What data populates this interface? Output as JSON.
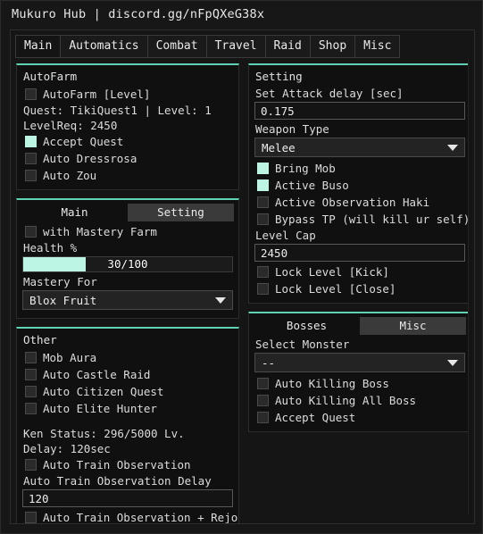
{
  "window": {
    "title": "Mukuro Hub | discord.gg/nFpQXeG38x"
  },
  "tabs": [
    {
      "label": "Main",
      "active": true
    },
    {
      "label": "Automatics",
      "active": false
    },
    {
      "label": "Combat",
      "active": false
    },
    {
      "label": "Travel",
      "active": false
    },
    {
      "label": "Raid",
      "active": false
    },
    {
      "label": "Shop",
      "active": false
    },
    {
      "label": "Misc",
      "active": false
    }
  ],
  "left": {
    "autofarm": {
      "title": "AutoFarm",
      "autofarm_level_label": "AutoFarm [Level]",
      "quest_status": "Quest: TikiQuest1 | Level: 1",
      "level_req": "LevelReq: 2450",
      "accept_quest_label": "Accept Quest",
      "auto_dressrosa_label": "Auto Dressrosa",
      "auto_zou_label": "Auto Zou"
    },
    "mastery": {
      "tab_main": "Main",
      "tab_setting": "Setting",
      "with_mastery_farm_label": "with Mastery Farm",
      "health_label": "Health %",
      "health_value": "30/100",
      "health_percent": 30,
      "mastery_for_label": "Mastery For",
      "mastery_for_value": "Blox Fruit"
    },
    "other": {
      "title": "Other",
      "mob_aura_label": "Mob Aura",
      "auto_castle_raid_label": "Auto Castle Raid",
      "auto_citizen_quest_label": "Auto Citizen Quest",
      "auto_elite_hunter_label": "Auto Elite Hunter",
      "ken_status": "Ken Status: 296/5000 Lv.",
      "delay": "Delay: 120sec",
      "auto_train_observation_label": "Auto Train Observation",
      "auto_train_delay_label": "Auto Train Observation Delay",
      "auto_train_delay_value": "120",
      "auto_train_rejoin_label": "Auto Train Observation + Rejoin"
    }
  },
  "right": {
    "setting": {
      "title": "Setting",
      "attack_delay_label": "Set Attack delay [sec]",
      "attack_delay_value": "0.175",
      "weapon_type_label": "Weapon Type",
      "weapon_type_value": "Melee",
      "bring_mob_label": "Bring Mob",
      "active_buso_label": "Active Buso",
      "active_observation_haki_label": "Active Observation Haki",
      "bypass_tp_label": "Bypass TP (will kill ur self)",
      "level_cap_label": "Level Cap",
      "level_cap_value": "2450",
      "lock_level_kick_label": "Lock Level [Kick]",
      "lock_level_close_label": "Lock Level [Close]"
    },
    "bosses": {
      "tab_bosses": "Bosses",
      "tab_misc": "Misc",
      "select_monster_label": "Select Monster",
      "select_monster_value": "--",
      "auto_killing_boss_label": "Auto Killing Boss",
      "auto_killing_all_boss_label": "Auto Killing All Boss",
      "accept_quest_label": "Accept Quest"
    }
  },
  "colors": {
    "accent": "#bdf5e4",
    "panel_top": "#5fd2b4",
    "background": "#141414",
    "panel": "#101010"
  }
}
